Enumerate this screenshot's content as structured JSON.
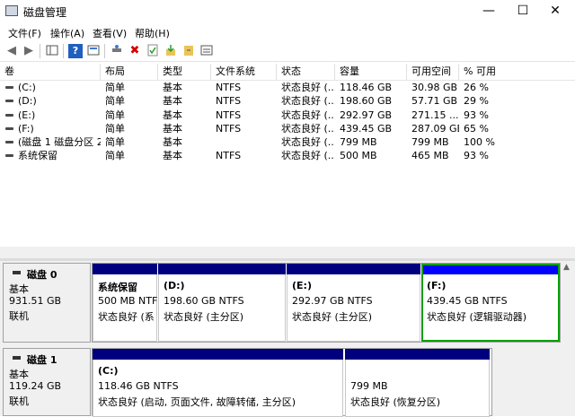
{
  "window": {
    "title": "磁盘管理",
    "minimize": "—",
    "maximize": "☐",
    "close": "✕"
  },
  "menu": {
    "file": "文件(F)",
    "action": "操作(A)",
    "view": "查看(V)",
    "help": "帮助(H)"
  },
  "toolbar": {
    "back_icon": "◀",
    "forward_icon": "▶",
    "delete_icon": "✖",
    "help_icon": "?"
  },
  "columns": [
    "卷",
    "布局",
    "类型",
    "文件系统",
    "状态",
    "容量",
    "可用空间",
    "% 可用"
  ],
  "volumes": [
    {
      "name": "(C:)",
      "layout": "简单",
      "type": "基本",
      "fs": "NTFS",
      "status": "状态良好 (...",
      "capacity": "118.46 GB",
      "free": "30.98 GB",
      "pct": "26 %"
    },
    {
      "name": "(D:)",
      "layout": "简单",
      "type": "基本",
      "fs": "NTFS",
      "status": "状态良好 (...",
      "capacity": "198.60 GB",
      "free": "57.71 GB",
      "pct": "29 %"
    },
    {
      "name": "(E:)",
      "layout": "简单",
      "type": "基本",
      "fs": "NTFS",
      "status": "状态良好 (...",
      "capacity": "292.97 GB",
      "free": "271.15 ...",
      "pct": "93 %"
    },
    {
      "name": "(F:)",
      "layout": "简单",
      "type": "基本",
      "fs": "NTFS",
      "status": "状态良好 (...",
      "capacity": "439.45 GB",
      "free": "287.09 GB",
      "pct": "65 %"
    },
    {
      "name": "(磁盘 1 磁盘分区 2)",
      "layout": "简单",
      "type": "基本",
      "fs": "",
      "status": "状态良好 (...",
      "capacity": "799 MB",
      "free": "799 MB",
      "pct": "100 %"
    },
    {
      "name": "系统保留",
      "layout": "简单",
      "type": "基本",
      "fs": "NTFS",
      "status": "状态良好 (...",
      "capacity": "500 MB",
      "free": "465 MB",
      "pct": "93 %"
    }
  ],
  "disks": [
    {
      "name": "磁盘 0",
      "type": "基本",
      "size": "931.51 GB",
      "state": "联机",
      "partitions": [
        {
          "name": "系统保留",
          "size": "500 MB NTFS",
          "status": "状态良好 (系"
        },
        {
          "name": "(D:)",
          "size": "198.60 GB NTFS",
          "status": "状态良好 (主分区)"
        },
        {
          "name": "(E:)",
          "size": "292.97 GB NTFS",
          "status": "状态良好 (主分区)"
        },
        {
          "name": "(F:)",
          "size": "439.45 GB NTFS",
          "status": "状态良好 (逻辑驱动器)"
        }
      ]
    },
    {
      "name": "磁盘 1",
      "type": "基本",
      "size": "119.24 GB",
      "state": "联机",
      "partitions": [
        {
          "name": "(C:)",
          "size": "118.46 GB NTFS",
          "status": "状态良好 (启动, 页面文件, 故障转储, 主分区)"
        },
        {
          "name": "",
          "size": "799 MB",
          "status": "状态良好 (恢复分区)"
        }
      ]
    }
  ]
}
